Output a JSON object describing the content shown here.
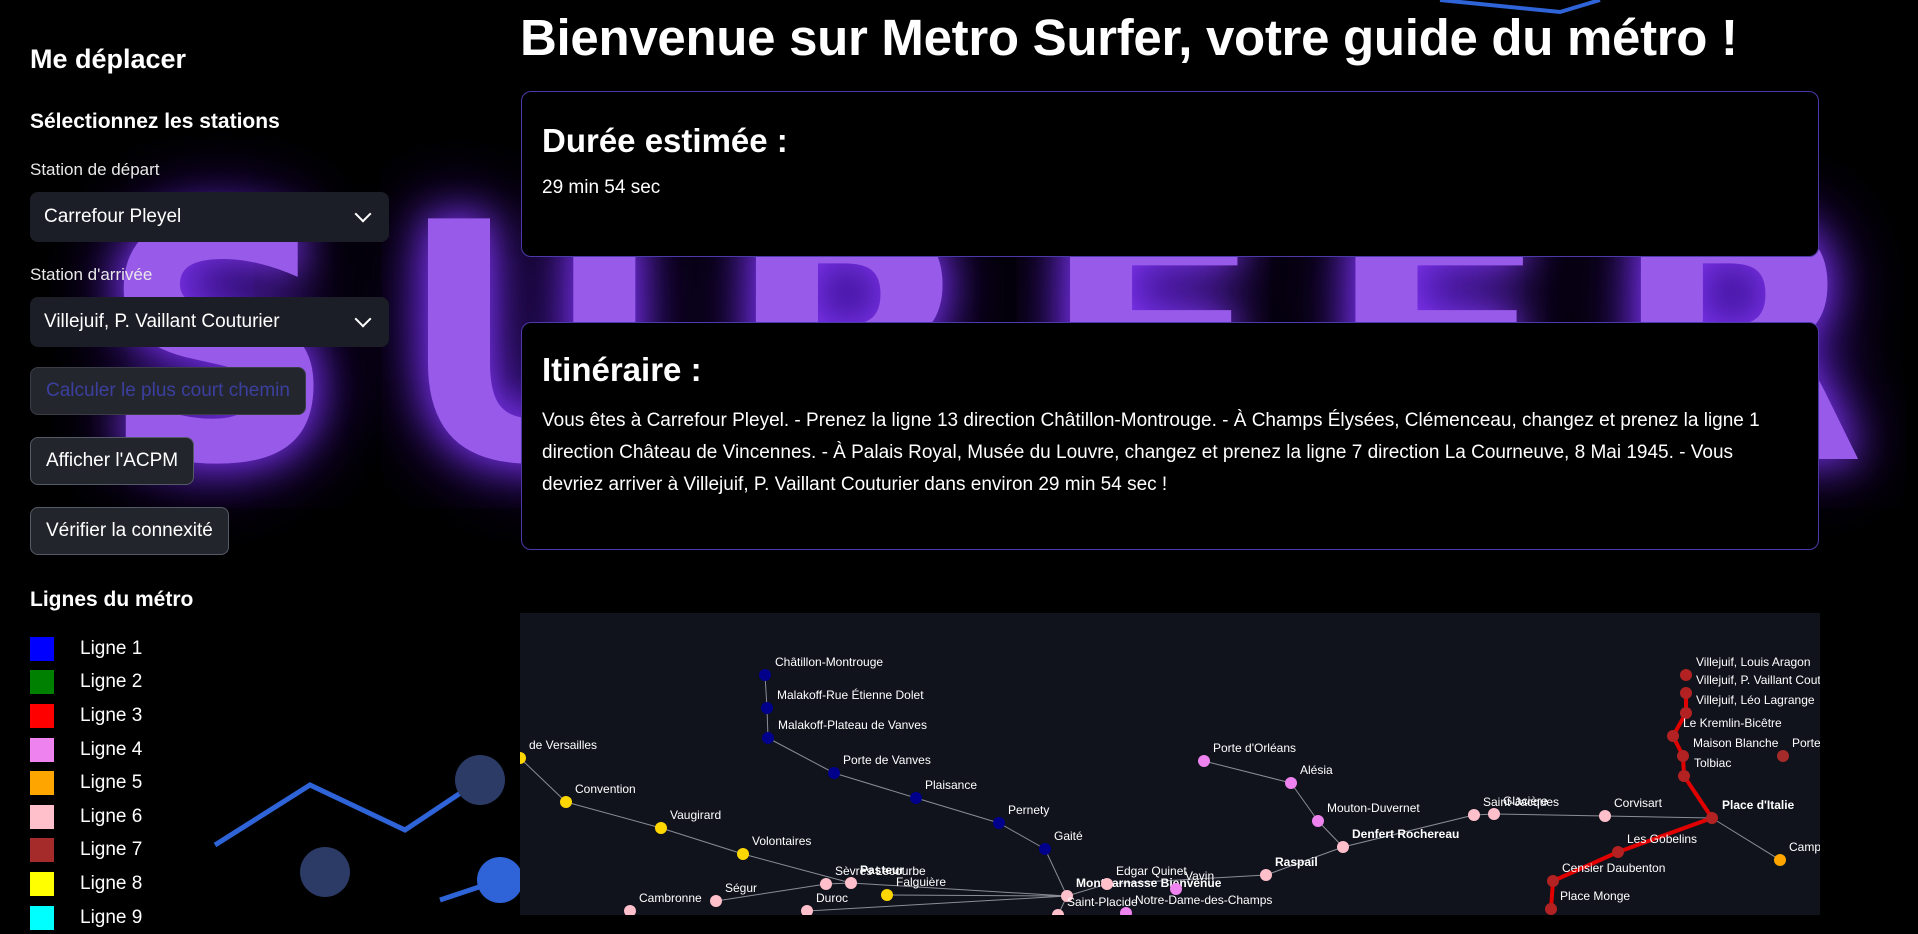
{
  "background": {
    "watermark": "SURFER"
  },
  "sidebar": {
    "title": "Me déplacer",
    "subtitle": "Sélectionnez les stations",
    "departure_label": "Station de départ",
    "departure_value": "Carrefour Pleyel",
    "arrival_label": "Station d'arrivée",
    "arrival_value": "Villejuif, P. Vaillant Couturier",
    "buttons": {
      "shortest": "Calculer le plus court chemin",
      "acpm": "Afficher l'ACPM",
      "connexity": "Vérifier la connexité"
    },
    "lines_title": "Lignes du métro",
    "lines": [
      {
        "label": "Ligne 1",
        "color": "#0000ff"
      },
      {
        "label": "Ligne 2",
        "color": "#008000"
      },
      {
        "label": "Ligne 3",
        "color": "#ff0000"
      },
      {
        "label": "Ligne 4",
        "color": "#ee82ee"
      },
      {
        "label": "Ligne 5",
        "color": "#ffa500"
      },
      {
        "label": "Ligne 6",
        "color": "#ffc0cb"
      },
      {
        "label": "Ligne 7",
        "color": "#a52a2a"
      },
      {
        "label": "Ligne 8",
        "color": "#ffff00"
      },
      {
        "label": "Ligne 9",
        "color": "#00ffff"
      }
    ]
  },
  "main": {
    "title": "Bienvenue sur Metro Surfer, votre guide du métro !",
    "duration_title": "Durée estimée :",
    "duration_value": "29 min 54 sec",
    "itinerary_title": "Itinéraire :",
    "itinerary_text": "Vous êtes à Carrefour Pleyel. - Prenez la ligne 13 direction Châtillon-Montrouge. - À Champs Élysées, Clémenceau, changez et prenez la ligne 1 direction Château de Vincennes. - À Palais Royal, Musée du Louvre, changez et prenez la ligne 7 direction La Courneuve, 8 Mai 1945. - Vous devriez arriver à Villejuif, P. Vaillant Couturier dans environ 29 min 54 sec !"
  },
  "map": {
    "stations": [
      "Châtillon-Montrouge",
      "Malakoff-Rue Étienne Dolet",
      "Malakoff-Plateau de Vanves",
      "Porte de Vanves",
      "Plaisance",
      "Pernety",
      "Gaité",
      "Montparnasse Bienvenue",
      "Convention",
      "Vaugirard",
      "Volontaires",
      "Pasteur",
      "Falguière",
      "Sèvres Lecourbe",
      "Porte d'Orléans",
      "Alésia",
      "Mouton-Duvernet",
      "Denfert Rochereau",
      "Raspail",
      "Edgar Quinet",
      "Vavin",
      "Notre-Dame-des-Champs",
      "Saint-Jacques",
      "Glacière",
      "Corvisart",
      "Place d'Italie",
      "Les Gobelins",
      "Censier Daubenton",
      "Place Monge",
      "Villejuif, Louis Aragon",
      "Villejuif, P. Vaillant Couturier",
      "Villejuif, Léo Lagrange",
      "Le Kremlin-Bicêtre",
      "Maison Blanche",
      "Tolbiac",
      "de Versailles",
      "Ségur",
      "Cambronne",
      "Duroc",
      "Saint-Placide",
      "Campo",
      "Porte"
    ]
  }
}
